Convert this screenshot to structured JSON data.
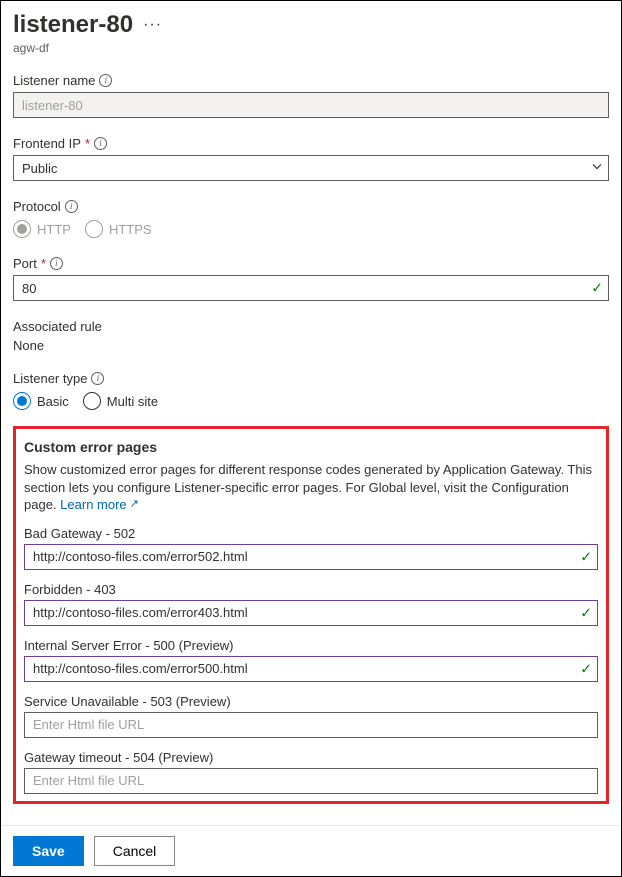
{
  "header": {
    "title": "listener-80",
    "subtitle": "agw-df"
  },
  "fields": {
    "listener_name": {
      "label": "Listener name",
      "value": "listener-80"
    },
    "frontend_ip": {
      "label": "Frontend IP",
      "value": "Public"
    },
    "protocol": {
      "label": "Protocol",
      "options": {
        "http": "HTTP",
        "https": "HTTPS"
      },
      "selected": "http"
    },
    "port": {
      "label": "Port",
      "value": "80"
    },
    "associated_rule": {
      "label": "Associated rule",
      "value": "None"
    },
    "listener_type": {
      "label": "Listener type",
      "options": {
        "basic": "Basic",
        "multi": "Multi site"
      },
      "selected": "basic"
    }
  },
  "custom_error": {
    "title": "Custom error pages",
    "description": "Show customized error pages for different response codes generated by Application Gateway. This section lets you configure Listener-specific error pages. For Global level, visit the Configuration page.",
    "learn_more": "Learn more",
    "items": [
      {
        "label": "Bad Gateway - 502",
        "value": "http://contoso-files.com/error502.html",
        "valid": true
      },
      {
        "label": "Forbidden - 403",
        "value": "http://contoso-files.com/error403.html",
        "valid": true
      },
      {
        "label": "Internal Server Error - 500 (Preview)",
        "value": "http://contoso-files.com/error500.html",
        "valid": true
      },
      {
        "label": "Service Unavailable - 503 (Preview)",
        "value": "",
        "placeholder": "Enter Html file URL",
        "valid": false
      },
      {
        "label": "Gateway timeout - 504 (Preview)",
        "value": "",
        "placeholder": "Enter Html file URL",
        "valid": false
      }
    ]
  },
  "footer": {
    "save": "Save",
    "cancel": "Cancel"
  }
}
